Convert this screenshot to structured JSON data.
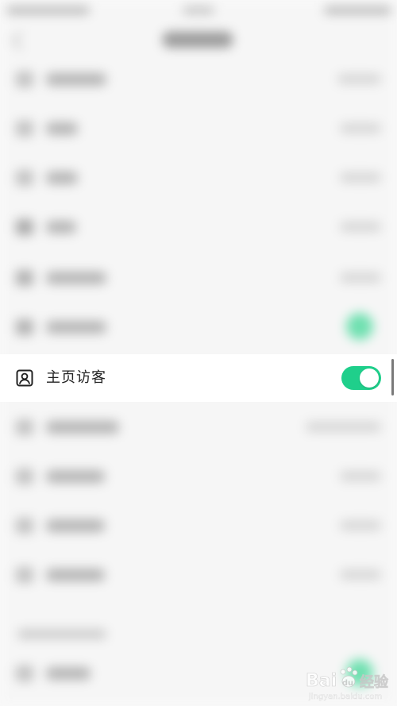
{
  "focused_setting": {
    "label": "主页访客",
    "icon": "user-profile-icon",
    "toggle_on": true
  },
  "colors": {
    "toggle_on": "#1fcf8b",
    "background": "#f6f6f6"
  },
  "watermark": {
    "brand": "Bai du 经验",
    "url": "jingyan.baidu.com"
  }
}
